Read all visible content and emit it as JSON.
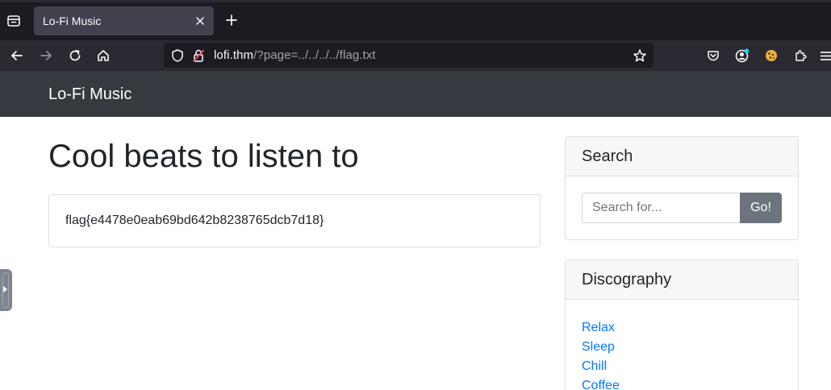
{
  "browser": {
    "tab": {
      "title": "Lo-Fi Music"
    },
    "url": {
      "host": "lofi.thm",
      "path": "/?page=../../../../flag.txt"
    }
  },
  "site": {
    "brand": "Lo-Fi Music",
    "heading": "Cool beats to listen to",
    "flag_text": "flag{e4478e0eab69bd642b8238765dcb7d18}"
  },
  "search": {
    "title": "Search",
    "placeholder": "Search for...",
    "button_label": "Go!"
  },
  "discography": {
    "title": "Discography",
    "items": [
      "Relax",
      "Sleep",
      "Chill",
      "Coffee"
    ]
  },
  "colors": {
    "link": "#007bff",
    "navbar": "#343a40",
    "button": "#6c757d"
  }
}
